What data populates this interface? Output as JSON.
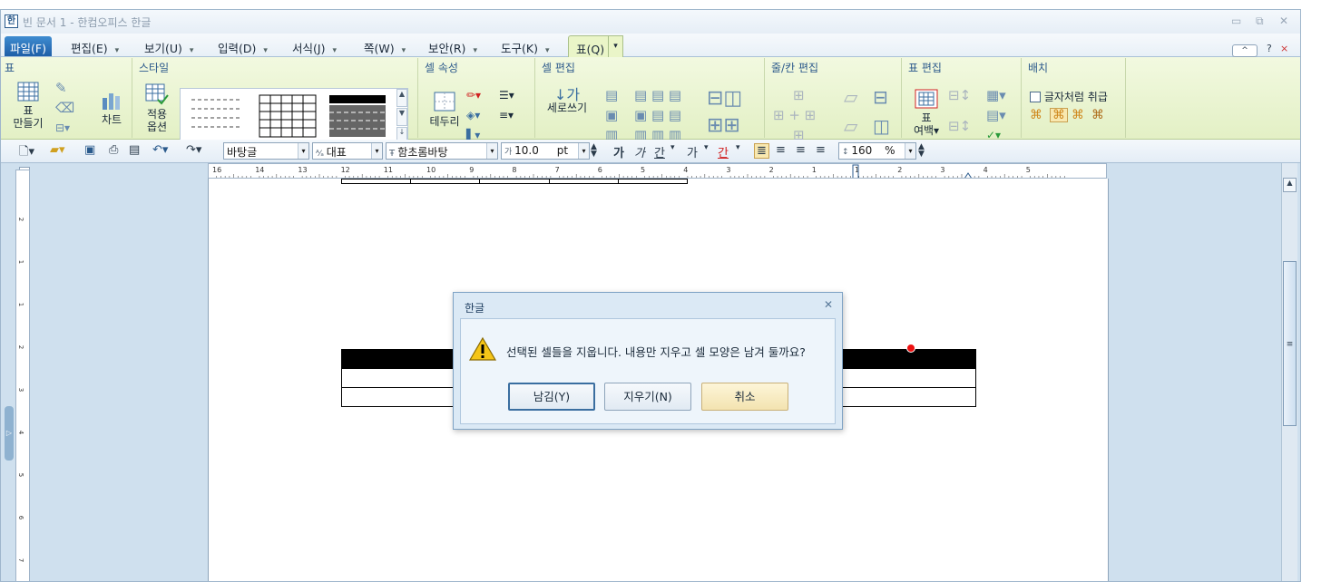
{
  "window": {
    "title": "빈 문서 1 - 한컴오피스 한글",
    "logo": "한"
  },
  "menu": [
    {
      "id": "file",
      "label": "파일(F)"
    },
    {
      "id": "edit",
      "label": "편집(E)"
    },
    {
      "id": "view",
      "label": "보기(U)"
    },
    {
      "id": "insert",
      "label": "입력(D)"
    },
    {
      "id": "format",
      "label": "서식(J)"
    },
    {
      "id": "page",
      "label": "쪽(W)"
    },
    {
      "id": "security",
      "label": "보안(R)"
    },
    {
      "id": "tools",
      "label": "도구(K)"
    },
    {
      "id": "table",
      "label": "표(Q)"
    }
  ],
  "ribbon": {
    "groups": {
      "table": "표",
      "style": "스타일",
      "cell_props": "셀 속성",
      "cell_edit": "셀 편집",
      "row_col_edit": "줄/칸 편집",
      "table_edit": "표 편집",
      "arrange": "배치"
    },
    "make_table_line1": "표",
    "make_table_line2": "만들기",
    "chart": "차트",
    "apply_line1": "적용",
    "apply_line2": "옵션",
    "border": "테두리",
    "vertical_text": "세로쓰기",
    "margin_line1": "표",
    "margin_line2": "여백",
    "treat_as_char": "글자처럼 취급"
  },
  "format_bar": {
    "style_name": "바탕글",
    "lang": "대표",
    "font_name": "함초롬바탕",
    "font_size": "10.0",
    "font_unit": "pt",
    "line_spacing": "160",
    "line_spacing_unit": "%",
    "bold": "가",
    "italic": "가",
    "underline": "간",
    "strike": "가",
    "color_text": "간"
  },
  "ruler": {
    "labels": [
      "16",
      "14",
      "13",
      "12",
      "11",
      "10",
      "9",
      "8",
      "7",
      "6",
      "5",
      "4",
      "3",
      "2",
      "1",
      "1",
      "2",
      "3",
      "4",
      "5"
    ]
  },
  "dialog": {
    "title": "한글",
    "message": "선택된 셀들을 지웁니다. 내용만 지우고 셀 모양은 남겨 둘까요?",
    "keep_label": "남김(Y)",
    "delete_label": "지우기(N)",
    "cancel_label": "취소"
  },
  "colors": {
    "ribbon_bg": "#e9f5cf",
    "app_bg": "#cfe0ee",
    "accent": "#1f5fa8",
    "marker": "#ee1111"
  }
}
